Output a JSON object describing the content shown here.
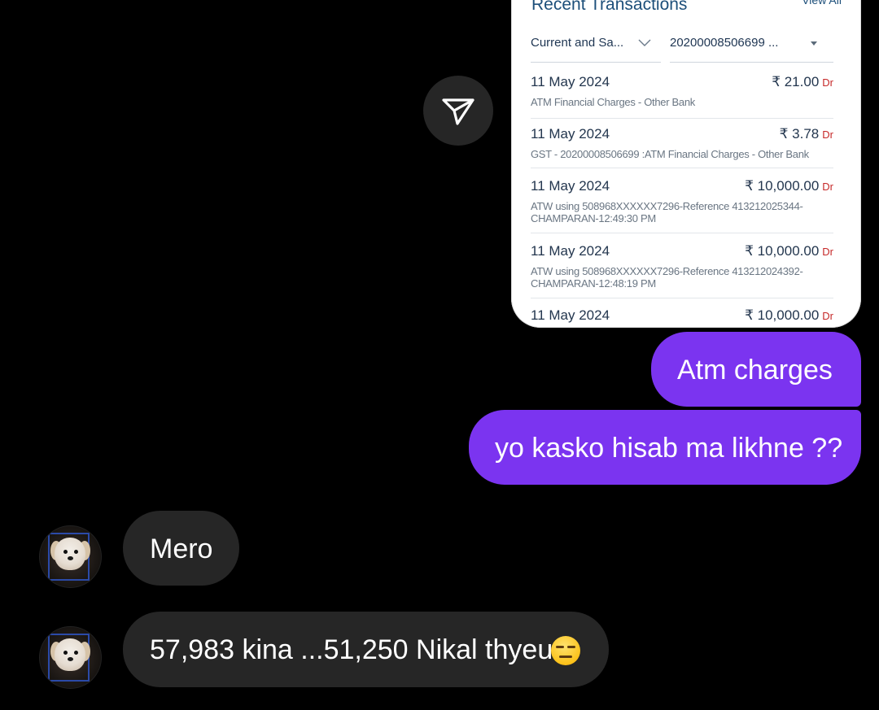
{
  "shared_screenshot": {
    "title": "Recent Transactions",
    "view_all": "View All",
    "account_filter": "Current and Sa...",
    "account_number": "20200008506699 ...",
    "transactions": [
      {
        "date": "11 May 2024",
        "amount": "₹ 21.00",
        "type": "Dr",
        "description": "ATM Financial Charges - Other Bank"
      },
      {
        "date": "11 May 2024",
        "amount": "₹ 3.78",
        "type": "Dr",
        "description": "GST - 20200008506699 :ATM Financial Charges - Other Bank"
      },
      {
        "date": "11 May 2024",
        "amount": "₹ 10,000.00",
        "type": "Dr",
        "description": "ATW using 508968XXXXXX7296-Reference 413212025344-CHAMPARAN-12:49:30 PM"
      },
      {
        "date": "11 May 2024",
        "amount": "₹ 10,000.00",
        "type": "Dr",
        "description": "ATW using 508968XXXXXX7296-Reference 413212024392-CHAMPARAN-12:48:19 PM"
      },
      {
        "date": "11 May 2024",
        "amount": "₹ 10,000.00",
        "type": "Dr",
        "description": ""
      }
    ]
  },
  "share_button": {
    "icon": "send-icon"
  },
  "sent_messages": [
    {
      "text": "Atm charges"
    },
    {
      "text": "yo kasko hisab ma likhne ??"
    }
  ],
  "received_messages": [
    {
      "text": "Mero",
      "avatar": "dog-avatar"
    },
    {
      "text": "57,983 kina ...51,250 Nikal thyeu",
      "emoji": "expressionless-face",
      "avatar": "dog-avatar"
    }
  ],
  "colors": {
    "background": "#000000",
    "sent_bubble": "#7b34f0",
    "received_bubble": "#262626",
    "card_text": "#1d4f7a",
    "debit_red": "#c62828"
  }
}
